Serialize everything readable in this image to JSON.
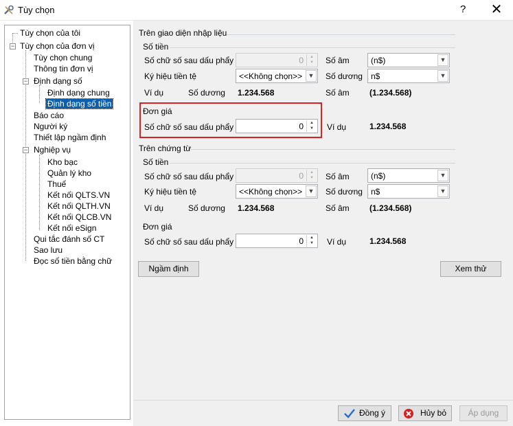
{
  "window": {
    "title": "Tùy chọn",
    "help": "?",
    "close": "✕"
  },
  "tree": {
    "root1": "Tùy chọn của tôi",
    "root2": "Tùy chọn của đơn vị",
    "items": {
      "general": "Tùy chọn chung",
      "unit_info": "Thông tin đơn vị",
      "format": "Định dạng số",
      "format_general": "Định dạng chung",
      "format_currency": "Định dạng số tiền",
      "report": "Báo cáo",
      "signer": "Người ký",
      "defaults": "Thiết lập ngầm định",
      "business": "Nghiệp vụ",
      "treasury": "Kho bạc",
      "warehouse": "Quản lý kho",
      "tax": "Thuế",
      "qlts": "Kết nối QLTS.VN",
      "qlth": "Kết nối QLTH.VN",
      "qlcb": "Kết nối QLCB.VN",
      "esign": "Kết nối eSign",
      "numbering": "Qui tắc đánh số CT",
      "backup": "Sao lưu",
      "read_money": "Đọc số tiền bằng chữ"
    }
  },
  "input_section": {
    "title": "Trên giao diện nhập liệu",
    "amount": {
      "title": "Số tiền",
      "decimals_label": "Số chữ số sau dấu phẩy",
      "decimals_value": "0",
      "symbol_label": "Ký hiệu tiền tệ",
      "symbol_value": "<<Không chọn>>",
      "example_label": "Ví dụ",
      "positive_label": "Số dương",
      "positive_example": "1.234.568",
      "negative_label": "Số âm",
      "negative_format": "(n$)",
      "positive_format_label": "Số dương",
      "positive_format": "n$",
      "negative_example_label": "Số âm",
      "negative_example": "(1.234.568)"
    },
    "unit_price": {
      "title": "Đơn giá",
      "decimals_label": "Số chữ số sau dấu phẩy",
      "decimals_value": "0",
      "example_label": "Ví dụ",
      "example": "1.234.568"
    }
  },
  "voucher_section": {
    "title": "Trên chứng từ",
    "amount": {
      "title": "Số tiền",
      "decimals_label": "Số chữ số sau dấu phẩy",
      "decimals_value": "0",
      "symbol_label": "Ký hiệu tiền tệ",
      "symbol_value": "<<Không chọn>>",
      "example_label": "Ví dụ",
      "positive_label": "Số dương",
      "positive_example": "1.234.568",
      "negative_label": "Số âm",
      "negative_format": "(n$)",
      "positive_format_label": "Số dương",
      "positive_format": "n$",
      "negative_example_label": "Số âm",
      "negative_example": "(1.234.568)"
    },
    "unit_price": {
      "title": "Đơn giá",
      "decimals_label": "Số chữ số sau dấu phẩy",
      "decimals_value": "0",
      "example_label": "Ví dụ",
      "example": "1.234.568"
    }
  },
  "buttons": {
    "default": "Ngầm định",
    "preview": "Xem thử",
    "ok": "Đồng ý",
    "cancel": "Hủy bỏ",
    "apply": "Áp dụng"
  },
  "colors": {
    "highlight": "#e02020",
    "selection": "#0a5fb0",
    "ok_check": "#1e6fd1",
    "cancel_icon": "#d42020"
  }
}
